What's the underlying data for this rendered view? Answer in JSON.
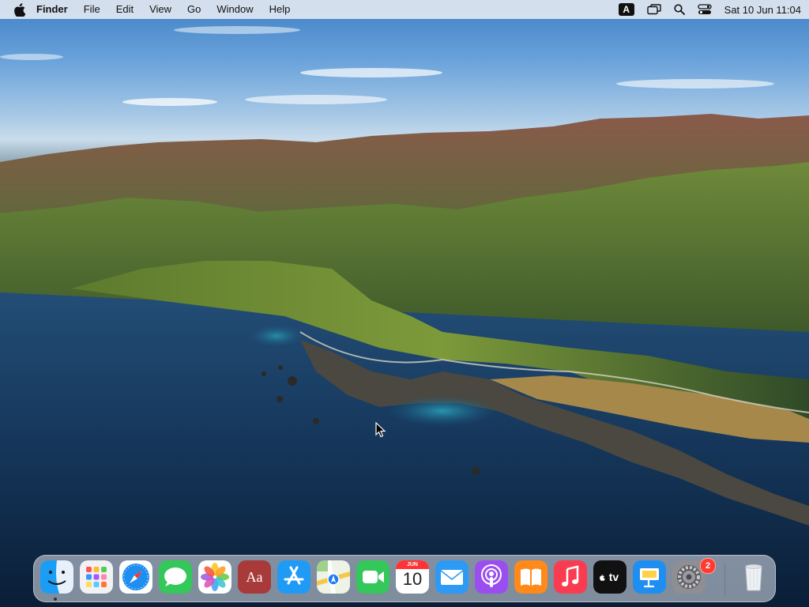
{
  "menubar": {
    "app_name": "Finder",
    "menus": [
      "File",
      "Edit",
      "View",
      "Go",
      "Window",
      "Help"
    ],
    "input_source": "A",
    "clock": "Sat 10 Jun  11:04",
    "status_icons": [
      "input-source-icon",
      "window-switcher-icon",
      "spotlight-search-icon",
      "control-center-icon"
    ]
  },
  "dock": {
    "apps": [
      "Finder",
      "Launchpad",
      "Safari",
      "Messages",
      "Photos",
      "Dictionary",
      "App Store",
      "Maps",
      "FaceTime",
      "Calendar",
      "Mail",
      "Podcasts",
      "Books",
      "Music",
      "TV",
      "Keynote",
      "System Preferences",
      "Trash"
    ],
    "calendar": {
      "month": "JUN",
      "day": "10"
    },
    "dictionary_label": "Aa",
    "tv_label": "tv",
    "system_preferences_badge": "2"
  },
  "colors": {
    "menubar_bg": "#e8ecf2",
    "badge": "#ff3b30",
    "ocean": "#0f2a48"
  }
}
